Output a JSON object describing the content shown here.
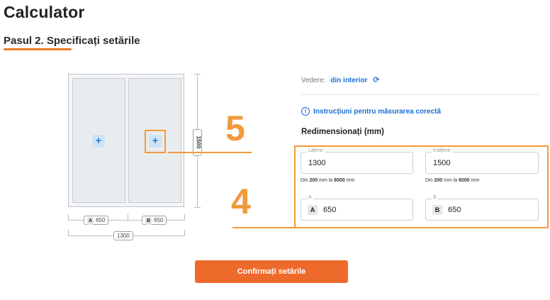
{
  "header": {
    "title": "Calculator",
    "step_title": "Pasul 2. Specificați setările"
  },
  "drawing": {
    "height_label": "1500",
    "sash_a_label": "A",
    "sash_a_value": "650",
    "sash_b_label": "B",
    "sash_b_value": "650",
    "total_width": "1300",
    "plus_symbol": "+"
  },
  "callouts": {
    "five": "5",
    "four": "4"
  },
  "panel": {
    "view_label": "Vedere:",
    "view_value": "din interior",
    "instructions_link": "Instrucțiuni pentru măsurarea corectă",
    "resize_title": "Redimensionați (mm)",
    "width_field": {
      "legend": "Lățime",
      "value": "1300"
    },
    "height_field": {
      "legend": "Înălțime",
      "value": "1500"
    },
    "hint_prefix": "Din",
    "hint_min": "200",
    "hint_mid": "mm la",
    "hint_max": "6000",
    "hint_suffix": "mm",
    "a_field": {
      "legend": "A",
      "badge": "A",
      "value": "650"
    },
    "b_field": {
      "legend": "B",
      "badge": "B",
      "value": "650"
    }
  },
  "confirm_button": "Confirmați setările",
  "colors": {
    "accent_orange": "#ee6a2b",
    "callout_orange": "#f29a3c",
    "link_blue": "#1b6fd1"
  },
  "icons": [
    "refresh-icon",
    "info-icon",
    "plus-icon"
  ]
}
